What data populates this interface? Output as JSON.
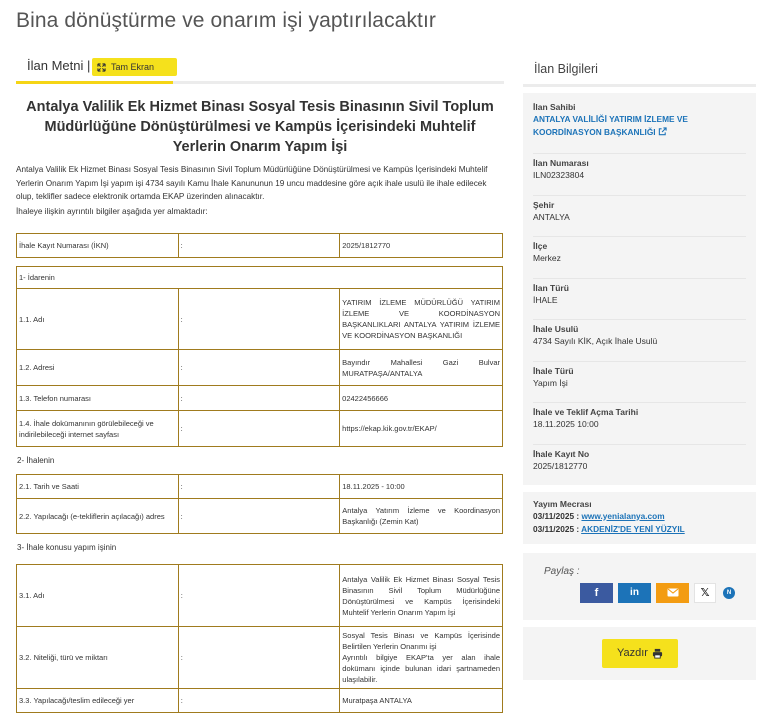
{
  "page": {
    "title": "Bina dönüştürme ve onarım işi yaptırılacaktır"
  },
  "tabs": {
    "active_label": "İlan Metni |",
    "fullscreen_label": "Tam Ekran"
  },
  "document": {
    "title": "Antalya Valilik Ek Hizmet Binası Sosyal Tesis Binasının Sivil Toplum Müdürlüğüne Dönüştürülmesi ve Kampüs İçerisindeki Muhtelif Yerlerin Onarım Yapım İşi",
    "intro_1": "Antalya Valilik Ek Hizmet Binası Sosyal Tesis Binasının Sivil Toplum Müdürlüğüne Dönüştürülmesi ve Kampüs İçerisindeki Muhtelif Yerlerin Onarım Yapım İşi yapım işi 4734 sayılı Kamu İhale Kanununun 19 uncu maddesine göre açık ihale usulü ile ihale edilecek olup, teklifler sadece elektronik ortamda EKAP üzerinden alınacaktır.",
    "intro_2": " İhaleye ilişkin ayrıntılı bilgiler aşağıda yer almaktadır:",
    "ikn": {
      "label": "İhale Kayıt Numarası (İKN)",
      "sep": ":",
      "value": "2025/1812770"
    },
    "sec1_title": "1- İdarenin",
    "sec1_rows": [
      {
        "label": "1.1. Adı",
        "sep": ":",
        "value": "YATIRIM İZLEME MÜDÜRLÜĞÜ YATIRIM İZLEME VE KOORDİNASYON BAŞKANLIKLARI ANTALYA YATIRIM İZLEME VE KOORDİNASYON BAŞKANLIĞI"
      },
      {
        "label": "1.2. Adresi",
        "sep": ":",
        "value": "Bayındır Mahallesi Gazi Bulvar MURATPAŞA/ANTALYA"
      },
      {
        "label": "1.3. Telefon numarası",
        "sep": ":",
        "value": "02422456666"
      },
      {
        "label": "1.4. İhale dokümanının görülebileceği ve indirilebileceği internet sayfası",
        "sep": ":",
        "value": "https://ekap.kik.gov.tr/EKAP/"
      }
    ],
    "sec2_title": "2- İhalenin",
    "sec2_rows": [
      {
        "label": "2.1. Tarih ve Saati",
        "sep": ":",
        "value": "18.11.2025 - 10:00"
      },
      {
        "label": "2.2. Yapılacağı (e-tekliflerin açılacağı) adres",
        "sep": ":",
        "value": "Antalya Yatırım İzleme ve Koordinasyon Başkanlığı (Zemin Kat)"
      }
    ],
    "sec3_title": "3- İhale konusu yapım işinin",
    "sec3_rows": [
      {
        "label": "3.1. Adı",
        "sep": ":",
        "value": "Antalya Valilik Ek Hizmet Binası Sosyal Tesis Binasının Sivil Toplum Müdürlüğüne Dönüştürülmesi ve Kampüs İçerisindeki Muhtelif Yerlerin Onarım Yapım İşi"
      },
      {
        "label": "3.2. Niteliği, türü ve miktarı",
        "sep": ":",
        "value_1": "Sosyal Tesis Binası ve Kampüs İçerisinde Belirtilen Yerlerin Onarımı işi",
        "value_2": "Ayrıntılı bilgiye EKAP'ta yer alan ihale dokümanı içinde bulunan idari şartnameden ulaşılabilir."
      },
      {
        "label": "3.3. Yapılacağı/teslim edileceği yer",
        "sep": ":",
        "value": "Muratpaşa ANTALYA"
      }
    ]
  },
  "sidebar": {
    "heading": "İlan Bilgileri",
    "items": [
      {
        "label": "İlan Sahibi",
        "value": "ANTALYA VALİLİĞİ YATIRIM İZLEME VE KOORDİNASYON BAŞKANLIĞI"
      },
      {
        "label": "İlan Numarası",
        "value": "ILN02323804"
      },
      {
        "label": "Şehir",
        "value": "ANTALYA"
      },
      {
        "label": "İlçe",
        "value": "Merkez"
      },
      {
        "label": "İlan Türü",
        "value": "İHALE"
      },
      {
        "label": "İhale Usulü",
        "value": "4734 Sayılı KİK, Açık İhale Usulü"
      },
      {
        "label": "İhale Türü",
        "value": "Yapım İşi"
      },
      {
        "label": "İhale ve Teklif Açma Tarihi",
        "value": "18.11.2025 10:00"
      },
      {
        "label": "İhale Kayıt No",
        "value": "2025/1812770"
      }
    ],
    "yayim": {
      "label": "Yayım Mecrası",
      "rows": [
        {
          "date": "03/11/2025 : ",
          "source": "www.yenialanya.com"
        },
        {
          "date": "03/11/2025 : ",
          "source": "AKDENİZ'DE YENİ YÜZYIL"
        }
      ]
    },
    "share": {
      "label": "Paylaş :",
      "icons": [
        "facebook-icon",
        "linkedin-icon",
        "email-icon",
        "x-icon",
        "nv-icon"
      ]
    },
    "print": {
      "label": "Yazdır"
    }
  },
  "colors": {
    "accent_yellow": "#f5e11c",
    "link_blue": "#1c73b8",
    "table_border": "#a07b1e"
  }
}
